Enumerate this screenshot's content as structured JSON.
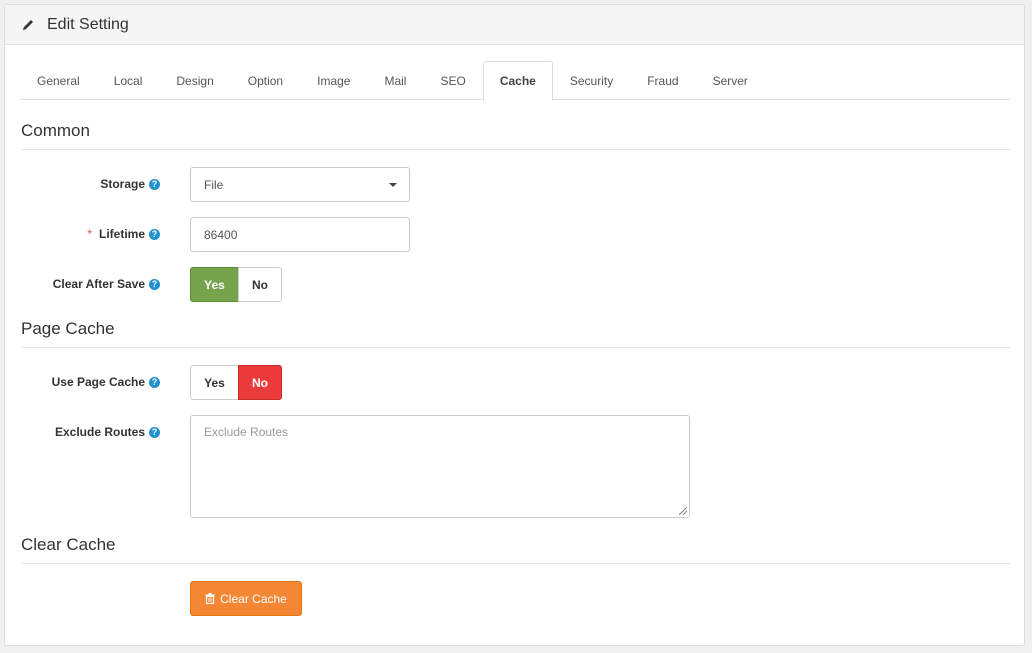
{
  "header": {
    "title": "Edit Setting",
    "icon": "pencil-icon"
  },
  "tabs": [
    {
      "label": "General",
      "active": false
    },
    {
      "label": "Local",
      "active": false
    },
    {
      "label": "Design",
      "active": false
    },
    {
      "label": "Option",
      "active": false
    },
    {
      "label": "Image",
      "active": false
    },
    {
      "label": "Mail",
      "active": false
    },
    {
      "label": "SEO",
      "active": false
    },
    {
      "label": "Cache",
      "active": true
    },
    {
      "label": "Security",
      "active": false
    },
    {
      "label": "Fraud",
      "active": false
    },
    {
      "label": "Server",
      "active": false
    }
  ],
  "sections": {
    "common": "Common",
    "page_cache": "Page Cache",
    "clear_cache": "Clear Cache"
  },
  "common": {
    "storage": {
      "label": "Storage",
      "value": "File"
    },
    "lifetime": {
      "label": "Lifetime",
      "required_mark": "*",
      "value": "86400"
    },
    "clear_after_save": {
      "label": "Clear After Save",
      "yes": "Yes",
      "no": "No",
      "selected": "Yes"
    }
  },
  "page_cache": {
    "use_page_cache": {
      "label": "Use Page Cache",
      "yes": "Yes",
      "no": "No",
      "selected": "No"
    },
    "exclude_routes": {
      "label": "Exclude Routes",
      "placeholder": "Exclude Routes",
      "value": ""
    }
  },
  "clear_cache": {
    "button_label": "Clear Cache",
    "icon": "trash-icon"
  },
  "colors": {
    "help": "#1e91cf",
    "yes_active": "#76a44c",
    "no_active": "#ec3b3b",
    "clear_button": "#f38733",
    "required": "#e3503e"
  }
}
